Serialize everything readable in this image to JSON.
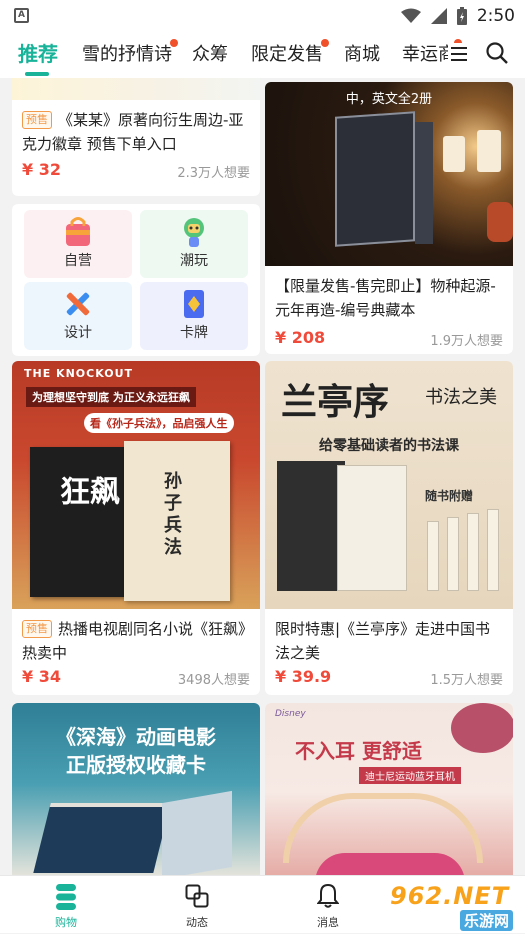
{
  "status_bar": {
    "app_letter": "A",
    "time": "2:50"
  },
  "tabs": [
    {
      "label": "推荐",
      "active": true,
      "dot": false
    },
    {
      "label": "雪的抒情诗",
      "active": false,
      "dot": true
    },
    {
      "label": "众筹",
      "active": false,
      "dot": false
    },
    {
      "label": "限定发售",
      "active": false,
      "dot": true
    },
    {
      "label": "商城",
      "active": false,
      "dot": false
    },
    {
      "label": "幸运商",
      "active": false,
      "dot": true
    }
  ],
  "feed": {
    "card1": {
      "badge": "预售",
      "title": "《某某》原著向衍生周边-亚克力徽章 预售下单入口",
      "price": "¥ 32",
      "want": "2.3万人想要"
    },
    "categories": [
      {
        "label": "自营",
        "icon": "shopping-bag-icon"
      },
      {
        "label": "潮玩",
        "icon": "toy-figure-icon"
      },
      {
        "label": "设计",
        "icon": "pencil-ruler-icon"
      },
      {
        "label": "卡牌",
        "icon": "card-icon"
      }
    ],
    "card2": {
      "image_text": "中，英文全2册",
      "title": "【限量发售-售完即止】物种起源-元年再造-编号典藏本",
      "price": "¥ 208",
      "want": "1.9万人想要"
    },
    "card3": {
      "image_text_1": "THE KNOCKOUT",
      "image_text_2": "为理想坚守到底 为正义永远狂飙",
      "image_text_3": "看《孙子兵法》，品启强人生",
      "badge": "预售",
      "title": "热播电视剧同名小说《狂飙》热卖中",
      "price": "¥ 34",
      "want": "3498人想要"
    },
    "card4": {
      "image_text_1": "兰亭序",
      "image_text_2": "书法之美",
      "image_text_3": "给零基础读者的书法课",
      "image_text_4": "随书附赠",
      "title": "限时特惠|《兰亭序》走进中国书法之美",
      "price": "¥ 39.9",
      "want": "1.5万人想要"
    },
    "card5": {
      "image_text_1": "《深海》动画电影",
      "image_text_2": "正版授权收藏卡"
    },
    "card6": {
      "image_text_1": "Disney",
      "image_text_2": "不入耳 更舒适",
      "image_text_3": "迪士尼运动蓝牙耳机"
    }
  },
  "bottom_nav": [
    {
      "label": "购物",
      "icon": "shopping-icon",
      "active": true
    },
    {
      "label": "动态",
      "icon": "feed-icon",
      "active": false
    },
    {
      "label": "消息",
      "icon": "bell-icon",
      "active": false
    }
  ],
  "watermark": {
    "line1": "962.NET",
    "line2": "乐游网"
  },
  "colors": {
    "accent": "#19b39a",
    "price": "#f04a3a",
    "badge": "#f2994a",
    "dot": "#f0502a"
  }
}
